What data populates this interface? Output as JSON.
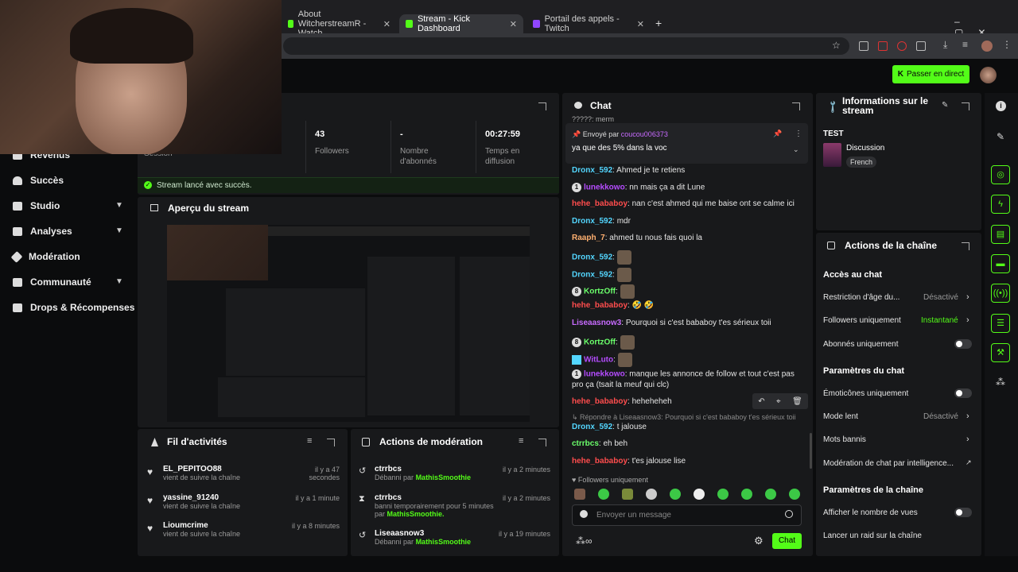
{
  "browser": {
    "tabs": [
      {
        "label": "About WitcherstreamR - Watch",
        "color": "#53fc18"
      },
      {
        "label": "Stream - Kick Dashboard",
        "color": "#53fc18"
      },
      {
        "label": "Portail des appels - Twitch",
        "color": "#9146ff"
      }
    ]
  },
  "header": {
    "go_live": "Passer en direct"
  },
  "sidebar": {
    "items": [
      "Revenus",
      "Succès",
      "Studio",
      "Analyses",
      "Modération",
      "Communauté",
      "Drops & Récompenses"
    ]
  },
  "session": {
    "title_partial": "Session",
    "stats": [
      {
        "value": "43",
        "label": "Followers"
      },
      {
        "value": "-",
        "label": "Nombre d'abonnés"
      },
      {
        "value": "00:27:59",
        "label": "Temps en diffusion"
      }
    ],
    "success_msg": "Stream lancé avec succès."
  },
  "preview": {
    "title": "Aperçu du stream"
  },
  "activity": {
    "title": "Fil d'activités",
    "items": [
      {
        "name": "EL_PEPITOO88",
        "sub": "vient de suivre la chaîne",
        "time": "il y a 47 secondes"
      },
      {
        "name": "yassine_91240",
        "sub": "vient de suivre la chaîne",
        "time": "il y a 1 minute"
      },
      {
        "name": "Lioumcrime",
        "sub": "vient de suivre la chaîne",
        "time": "il y a 8 minutes"
      }
    ]
  },
  "moderation": {
    "title": "Actions de modération",
    "items": [
      {
        "name": "ctrrbcs",
        "sub": "Débanni par",
        "by": "MathisSmoothie",
        "time": "il y a 2 minutes"
      },
      {
        "name": "ctrrbcs",
        "sub": "banni temporairement pour 5 minutes par",
        "by": "MathisSmoothie.",
        "time": "il y a 2 minutes"
      },
      {
        "name": "Liseaasnow3",
        "sub": "Débanni par",
        "by": "MathisSmoothie",
        "time": "il y a 19 minutes"
      }
    ]
  },
  "chat": {
    "title": "Chat",
    "pinned": {
      "sent_by": "Envoyé par",
      "user": "coucou006373",
      "text": "ya que des 5% dans la voc"
    },
    "messages": [
      {
        "user": "Dronx_592",
        "color": "#53d6ff",
        "text": ": Ahmed je te retiens"
      },
      {
        "user": "lunekkowo",
        "color": "#b54cff",
        "text": ": nn mais ça a dit Lune",
        "badge": "1"
      },
      {
        "user": "hehe_bababoy",
        "color": "#ff4d4d",
        "text": ": nan c'est ahmed qui me baise ont se calme ici"
      },
      {
        "user": "Dronx_592",
        "color": "#53d6ff",
        "text": ": mdr"
      },
      {
        "user": "Raaph_7",
        "color": "#ffb070",
        "text": ": ahmed tu nous fais quoi la"
      },
      {
        "user": "Dronx_592",
        "color": "#53d6ff",
        "text": ":"
      },
      {
        "user": "Dronx_592",
        "color": "#53d6ff",
        "text": ":"
      },
      {
        "user": "KortzOff",
        "color": "#6bff6b",
        "text": ":",
        "badge": "8"
      },
      {
        "user": "hehe_bababoy",
        "color": "#ff4d4d",
        "text": ": 🤣 🤣"
      },
      {
        "user": "Liseaasnow3",
        "color": "#c86bff",
        "text": ": Pourquoi si c'est bababoy t'es sérieux toii"
      },
      {
        "user": "KortzOff",
        "color": "#6bff6b",
        "text": ":",
        "badge": "8"
      },
      {
        "user": "WitLuto",
        "color": "#b54cff",
        "text": ":"
      },
      {
        "user": "lunekkowo",
        "color": "#b54cff",
        "text": ": manque les annonce de follow et tout c'est pas",
        "badge": "1"
      },
      {
        "user": "",
        "color": "#e6e6e6",
        "text": "pro ça (tsait la meuf qui clc)"
      },
      {
        "user": "hehe_bababoy",
        "color": "#ff4d4d",
        "text": ": heheheheh"
      },
      {
        "user": "",
        "color": "#8a8a8a",
        "text": "↳ Répondre à Liseaasnow3: Pourquoi si c'est bababoy t'es sérieux toii"
      },
      {
        "user": "Dronx_592",
        "color": "#53d6ff",
        "text": ": t jalouse"
      },
      {
        "user": "ctrrbcs",
        "color": "#6bff6b",
        "text": ": eh beh"
      },
      {
        "user": "hehe_bababoy",
        "color": "#ff4d4d",
        "text": ": t'es jalouse lise"
      }
    ],
    "followers_only": "Followers uniquement",
    "placeholder": "Envoyer un message",
    "send": "Chat",
    "truncated_top": "?????: merm"
  },
  "stream_info": {
    "title": "Informations sur le stream",
    "stream_title": "TEST",
    "category": "Discussion",
    "language": "French"
  },
  "channel_actions": {
    "title": "Actions de la chaîne",
    "chat_access": "Accès au chat",
    "age_restriction": "Restriction d'âge du...",
    "age_value": "Désactivé",
    "followers_only": "Followers uniquement",
    "followers_value": "Instantané",
    "subs_only": "Abonnés uniquement",
    "chat_params": "Paramètres du chat",
    "emotes_only": "Émoticônes uniquement",
    "slow_mode": "Mode lent",
    "slow_value": "Désactivé",
    "banned_words": "Mots bannis",
    "ai_moderation": "Modération de chat par intelligence...",
    "channel_params": "Paramètres de la chaîne",
    "view_count": "Afficher le nombre de vues",
    "raid": "Lancer un raid sur la chaîne"
  }
}
